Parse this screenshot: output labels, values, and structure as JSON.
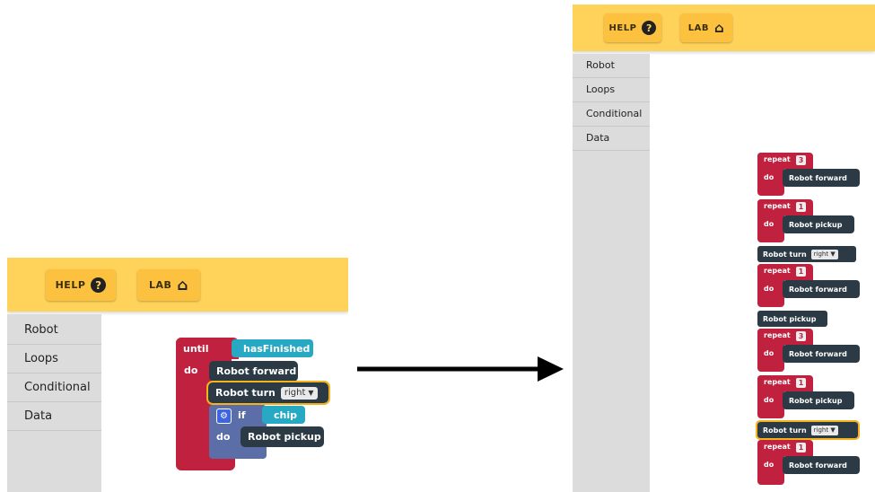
{
  "toolbar": {
    "help_label": "HELP",
    "help_icon": "?",
    "lab_label": "LAB",
    "lab_icon": "⌂"
  },
  "sidebar": {
    "items": [
      {
        "label": "Robot"
      },
      {
        "label": "Loops"
      },
      {
        "label": "Conditional"
      },
      {
        "label": "Data"
      }
    ]
  },
  "left_program": {
    "until_label": "until",
    "until_cond": "hasFinished",
    "do_label": "do",
    "forward": "Robot forward",
    "turn": "Robot turn",
    "turn_dir": "right",
    "if_label": "if",
    "if_cond": "chip",
    "if_do": "do",
    "pickup": "Robot pickup"
  },
  "right_program": {
    "repeat_label": "repeat",
    "do_label": "do",
    "forward": "Robot forward",
    "pickup": "Robot pickup",
    "turn": "Robot turn",
    "turn_dir": "right",
    "counts": [
      "3",
      "1",
      "1",
      "3",
      "1",
      "1"
    ]
  },
  "colors": {
    "toolbar": "#ffd35a",
    "loop": "#c0213f",
    "statement": "#2b3a44",
    "condition": "#27a9c3",
    "highlight": "#f4b21b"
  }
}
